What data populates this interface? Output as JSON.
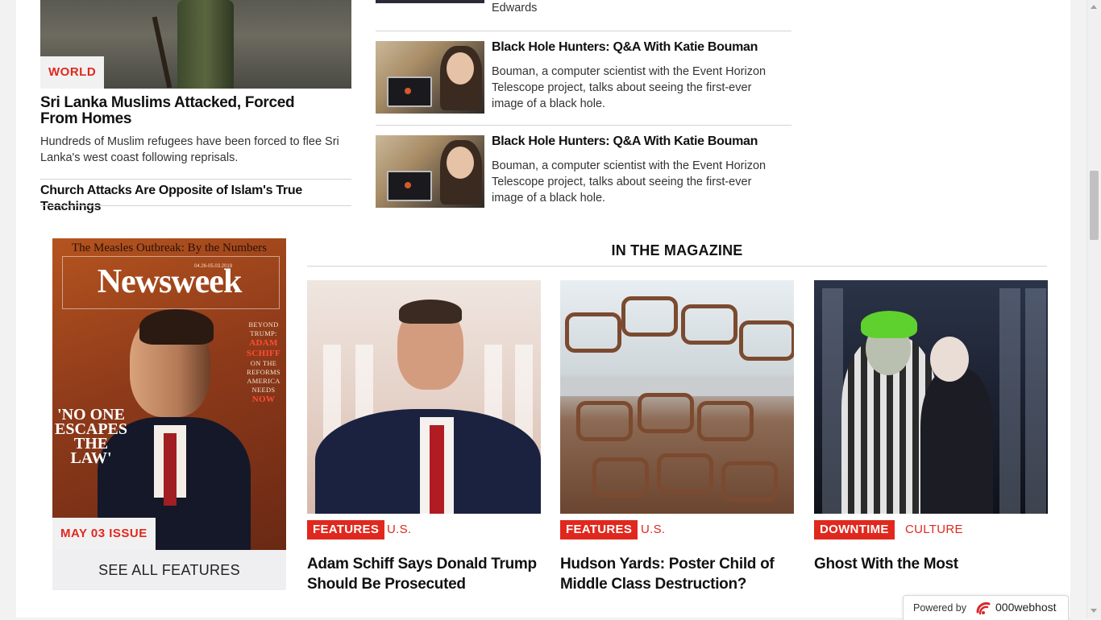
{
  "left_story": {
    "category": "WORLD",
    "headline": "Sri Lanka Muslims Attacked, Forced From Homes",
    "summary": "Hundreds of Muslim refugees have been forced to flee Sri Lanka's west coast following reprisals.",
    "related_headline": "Church Attacks Are Opposite of Islam's True Teachings"
  },
  "story_list": {
    "partial_text": "Edwards",
    "items": [
      {
        "title": "Black Hole Hunters: Q&A With Katie Bouman",
        "summary": "Bouman, a computer scientist with the Event Horizon Telescope project, talks about seeing the first-ever image of a black hole."
      },
      {
        "title": "Black Hole Hunters: Q&A With Katie Bouman",
        "summary": "Bouman, a computer scientist with the Event Horizon Telescope project, talks about seeing the first-ever image of a black hole."
      }
    ]
  },
  "magazine": {
    "section_title": "IN THE MAGAZINE",
    "cover": {
      "top_line": "The Measles Outbreak: By the Numbers",
      "masthead": "Newsweek",
      "date_line": "04.26-05.03.2019",
      "side_lines": [
        "BEYOND",
        "TRUMP:"
      ],
      "side_name": [
        "ADAM",
        "SCHIFF"
      ],
      "side_lines2": [
        "ON THE",
        "REFORMS",
        "AMERICA",
        "NEEDS"
      ],
      "side_now": "NOW",
      "quote": "'NO ONE ESCAPES THE LAW'"
    },
    "issue_label": "MAY 03 ISSUE",
    "see_all_label": "SEE ALL FEATURES",
    "cards": [
      {
        "tag": "FEATURES",
        "subtag": "U.S.",
        "headline": "Adam Schiff Says Donald Trump Should Be Prosecuted"
      },
      {
        "tag": "FEATURES",
        "subtag": "U.S.",
        "headline": "Hudson Yards: Poster Child of Middle Class Destruction?"
      },
      {
        "tag": "DOWNTIME",
        "subtag": "CULTURE",
        "headline": "Ghost With the Most"
      }
    ]
  },
  "footer_badge": {
    "label": "Powered by",
    "brand": "000webhost",
    "icon": "000webhost-logo-icon"
  },
  "colors": {
    "accent_red": "#e0281e",
    "text_dark": "#111111",
    "tag_background": "#f1f1f1"
  }
}
